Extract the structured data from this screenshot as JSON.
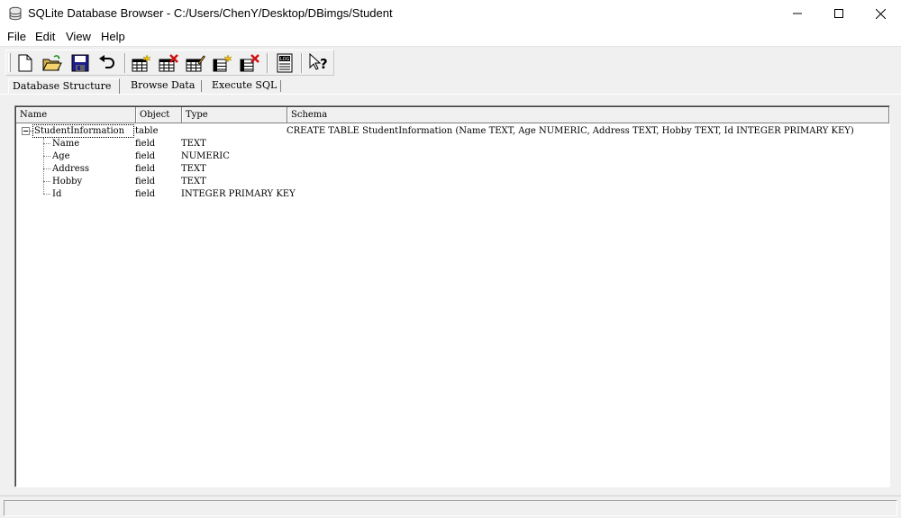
{
  "window": {
    "title": "SQLite Database Browser - C:/Users/ChenY/Desktop/DBimgs/Student",
    "icon": "database-icon",
    "controls": [
      "minimize-icon",
      "maximize-icon",
      "close-icon"
    ]
  },
  "menu": {
    "items": [
      {
        "label": "File"
      },
      {
        "label": "Edit"
      },
      {
        "label": "View"
      },
      {
        "label": "Help"
      }
    ]
  },
  "toolbar": {
    "buttons": [
      {
        "icon": "new-database-icon"
      },
      {
        "icon": "open-database-icon"
      },
      {
        "icon": "save-icon"
      },
      {
        "icon": "undo-icon"
      },
      {
        "icon": "create-table-icon"
      },
      {
        "icon": "delete-table-icon"
      },
      {
        "icon": "modify-table-icon"
      },
      {
        "icon": "create-index-icon"
      },
      {
        "icon": "delete-index-icon"
      },
      {
        "icon": "sql-log-icon"
      },
      {
        "icon": "whats-this-icon"
      }
    ]
  },
  "tabs": [
    {
      "label": "Database Structure",
      "active": true
    },
    {
      "label": "Browse Data",
      "active": false
    },
    {
      "label": "Execute SQL",
      "active": false
    }
  ],
  "tree": {
    "columns": [
      "Name",
      "Object",
      "Type",
      "Schema"
    ],
    "table": {
      "name": "StudentInformation",
      "object": "table",
      "type": "",
      "schema": "CREATE TABLE StudentInformation (Name TEXT, Age NUMERIC, Address TEXT, Hobby TEXT, Id INTEGER PRIMARY KEY)",
      "expanded": true
    },
    "fields": [
      {
        "name": "Name",
        "object": "field",
        "type": "TEXT"
      },
      {
        "name": "Age",
        "object": "field",
        "type": "NUMERIC"
      },
      {
        "name": "Address",
        "object": "field",
        "type": "TEXT"
      },
      {
        "name": "Hobby",
        "object": "field",
        "type": "TEXT"
      },
      {
        "name": "Id",
        "object": "field",
        "type": "INTEGER PRIMARY KEY"
      }
    ]
  },
  "status": {
    "text": ""
  }
}
